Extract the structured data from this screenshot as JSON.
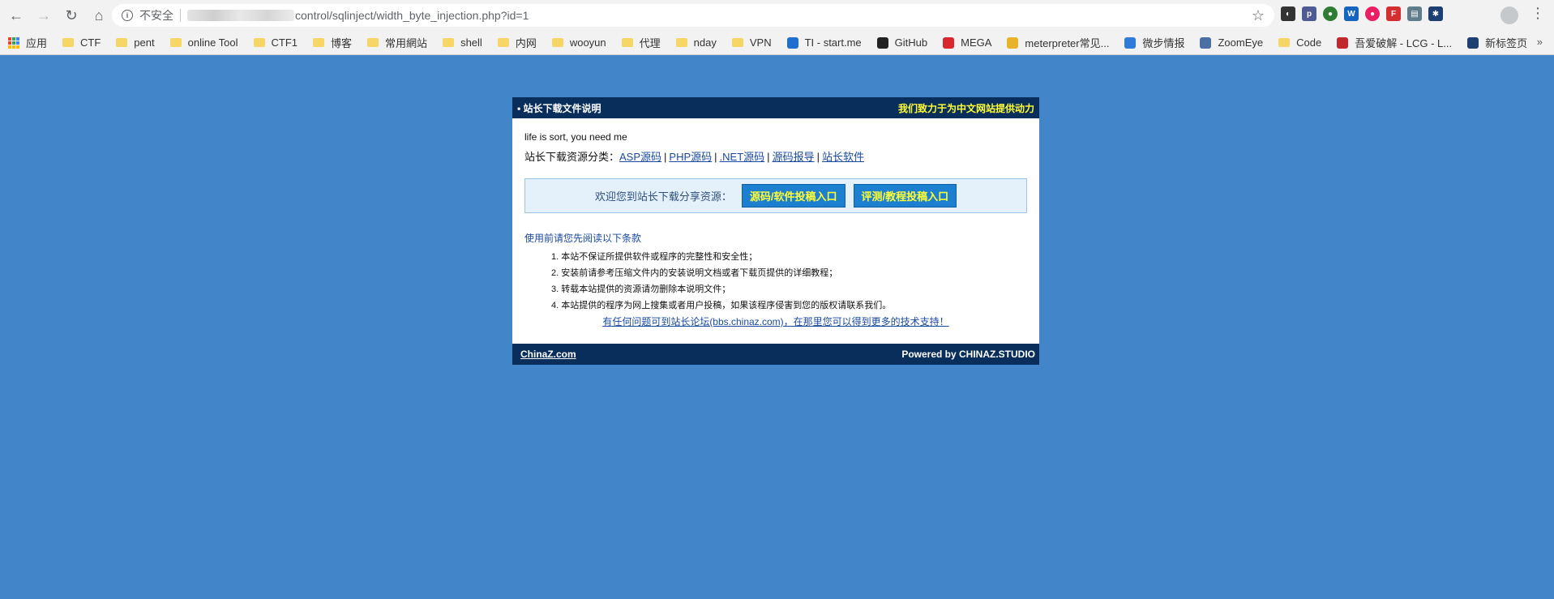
{
  "browser": {
    "security_label": "不安全",
    "url": "control/sqlinject/width_byte_injection.php?id=1",
    "bookmarks": [
      {
        "label": "应用",
        "kind": "apps"
      },
      {
        "label": "CTF",
        "kind": "folder"
      },
      {
        "label": "pent",
        "kind": "folder"
      },
      {
        "label": "online Tool",
        "kind": "folder"
      },
      {
        "label": "CTF1",
        "kind": "folder"
      },
      {
        "label": "博客",
        "kind": "folder"
      },
      {
        "label": "常用網站",
        "kind": "folder"
      },
      {
        "label": "shell",
        "kind": "folder"
      },
      {
        "label": "内网",
        "kind": "folder"
      },
      {
        "label": "wooyun",
        "kind": "folder"
      },
      {
        "label": "代理",
        "kind": "folder"
      },
      {
        "label": "nday",
        "kind": "folder"
      },
      {
        "label": "VPN",
        "kind": "folder"
      },
      {
        "label": "TI - start.me",
        "kind": "site",
        "color": "#1e6fd0"
      },
      {
        "label": "GitHub",
        "kind": "site",
        "color": "#222222"
      },
      {
        "label": "MEGA",
        "kind": "site",
        "color": "#d9272e"
      },
      {
        "label": "meterpreter常见...",
        "kind": "site",
        "color": "#e8b32a"
      },
      {
        "label": "微步情报",
        "kind": "site",
        "color": "#2f7bd9"
      },
      {
        "label": "ZoomEye",
        "kind": "site",
        "color": "#4a6fa5"
      },
      {
        "label": "Code",
        "kind": "folder"
      },
      {
        "label": "吾爱破解 - LCG - L...",
        "kind": "site",
        "color": "#c0282d"
      },
      {
        "label": "新标签页",
        "kind": "site",
        "color": "#1d3f72"
      }
    ],
    "more_label": "»"
  },
  "page": {
    "header_title": "• 站长下载文件说明",
    "header_slogan": "我们致力于为中文网站提供动力",
    "intro": "life is sort, you need me",
    "categories_prefix": "站长下载资源分类：",
    "categories": [
      "ASP源码",
      "PHP源码",
      ".NET源码",
      "源码报导",
      "站长软件"
    ],
    "pipe": "|",
    "share_text": "欢迎您到站长下载分享资源：",
    "share_buttons": [
      "源码/软件投稿入口",
      "评测/教程投稿入口"
    ],
    "notice_title": "使用前请您先阅读以下条款",
    "notices": [
      "1. 本站不保证所提供软件或程序的完整性和安全性；",
      "2. 安装前请参考压缩文件内的安装说明文档或者下载页提供的详细教程；",
      "3. 转载本站提供的资源请勿删除本说明文件；",
      "4. 本站提供的程序为网上搜集或者用户投稿，如果该程序侵害到您的版权请联系我们。"
    ],
    "forum_link": "有任何问题可到站长论坛(bbs.chinaz.com)，在那里您可以得到更多的技术支持！",
    "footer_left": "ChinaZ.com",
    "footer_right": "Powered by CHINAZ.STUDIO"
  },
  "colors": {
    "page_bg": "#4285c8",
    "panel_bar": "#0a2e5c",
    "slogan": "#ffff33",
    "button_bg": "#1d7fcf"
  }
}
